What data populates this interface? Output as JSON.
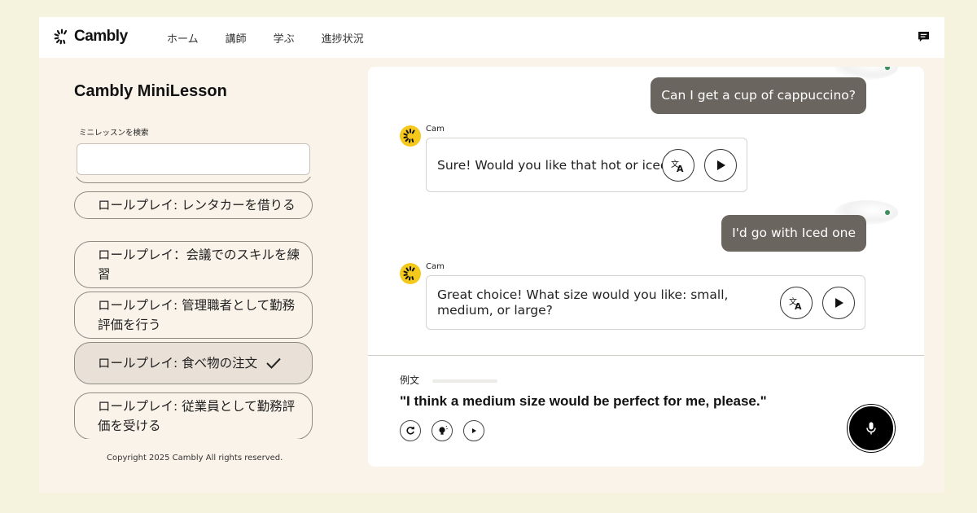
{
  "header": {
    "logo_text": "Cambly",
    "nav": [
      "ホーム",
      "講師",
      "学ぶ",
      "進捗状況"
    ]
  },
  "sidebar": {
    "title": "Cambly MiniLesson",
    "search_label": "ミニレッスンを検索",
    "search_value": "",
    "lessons": [
      {
        "label": "ロールプレイ: レンタカーを借りる",
        "selected": false
      },
      {
        "label": "ロールプレイ：会議でのスキルを練習",
        "selected": false
      },
      {
        "label": "ロールプレイ: 管理職者として勤務評価を行う",
        "selected": false
      },
      {
        "label": "ロールプレイ: 食べ物の注文",
        "selected": true
      },
      {
        "label": "ロールプレイ: 従業員として勤務評価を受ける",
        "selected": false
      }
    ],
    "copyright": "Copyright 2025 Cambly All rights reserved."
  },
  "chat": {
    "messages": [
      {
        "from": "user",
        "text": "Can I get a cup of cappuccino?"
      },
      {
        "from": "bot",
        "name": "Cam",
        "text": "Sure! Would you like that hot or iced?"
      },
      {
        "from": "user",
        "text": "I'd go with Iced one"
      },
      {
        "from": "bot",
        "name": "Cam",
        "text": "Great choice! What size would you like: small, medium, or large?"
      }
    ]
  },
  "example": {
    "label": "例文",
    "text": "\"I think a medium size would be perfect for me, please.\""
  },
  "icons": {
    "logo": "cambly-logo-icon",
    "chat": "chat-bubble-icon",
    "translate": "translate-icon",
    "play": "play-icon",
    "replay": "replay-icon",
    "hint": "lightbulb-icon",
    "mic": "microphone-icon",
    "check": "checkmark-icon"
  },
  "colors": {
    "page_bg": "#f5f3dd",
    "app_bg": "#faf3ea",
    "user_bubble": "#6b655f",
    "bot_avatar": "#f4c91c",
    "selected_item": "#e9e0d7"
  }
}
